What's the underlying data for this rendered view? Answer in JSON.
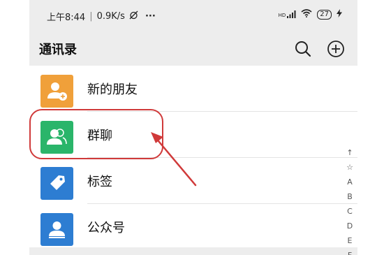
{
  "status_bar": {
    "time": "上午8:44",
    "speed": "0.9K/s",
    "more": "···",
    "network": "HD",
    "battery": "27"
  },
  "header": {
    "title": "通讯录",
    "actions": [
      "search-icon",
      "add-circle-icon"
    ]
  },
  "contacts": [
    {
      "label": "新的朋友",
      "icon": "new-friend-icon",
      "color": "#f0a03a"
    },
    {
      "label": "群聊",
      "icon": "group-chat-icon",
      "color": "#2ab56a"
    },
    {
      "label": "标签",
      "icon": "tag-icon",
      "color": "#2d7dd2"
    },
    {
      "label": "公众号",
      "icon": "official-account-icon",
      "color": "#2d7dd2"
    }
  ],
  "index_bar": [
    "↑",
    "☆",
    "A",
    "B",
    "C",
    "D",
    "E",
    "F"
  ],
  "annotation_color": "#d03a3a"
}
